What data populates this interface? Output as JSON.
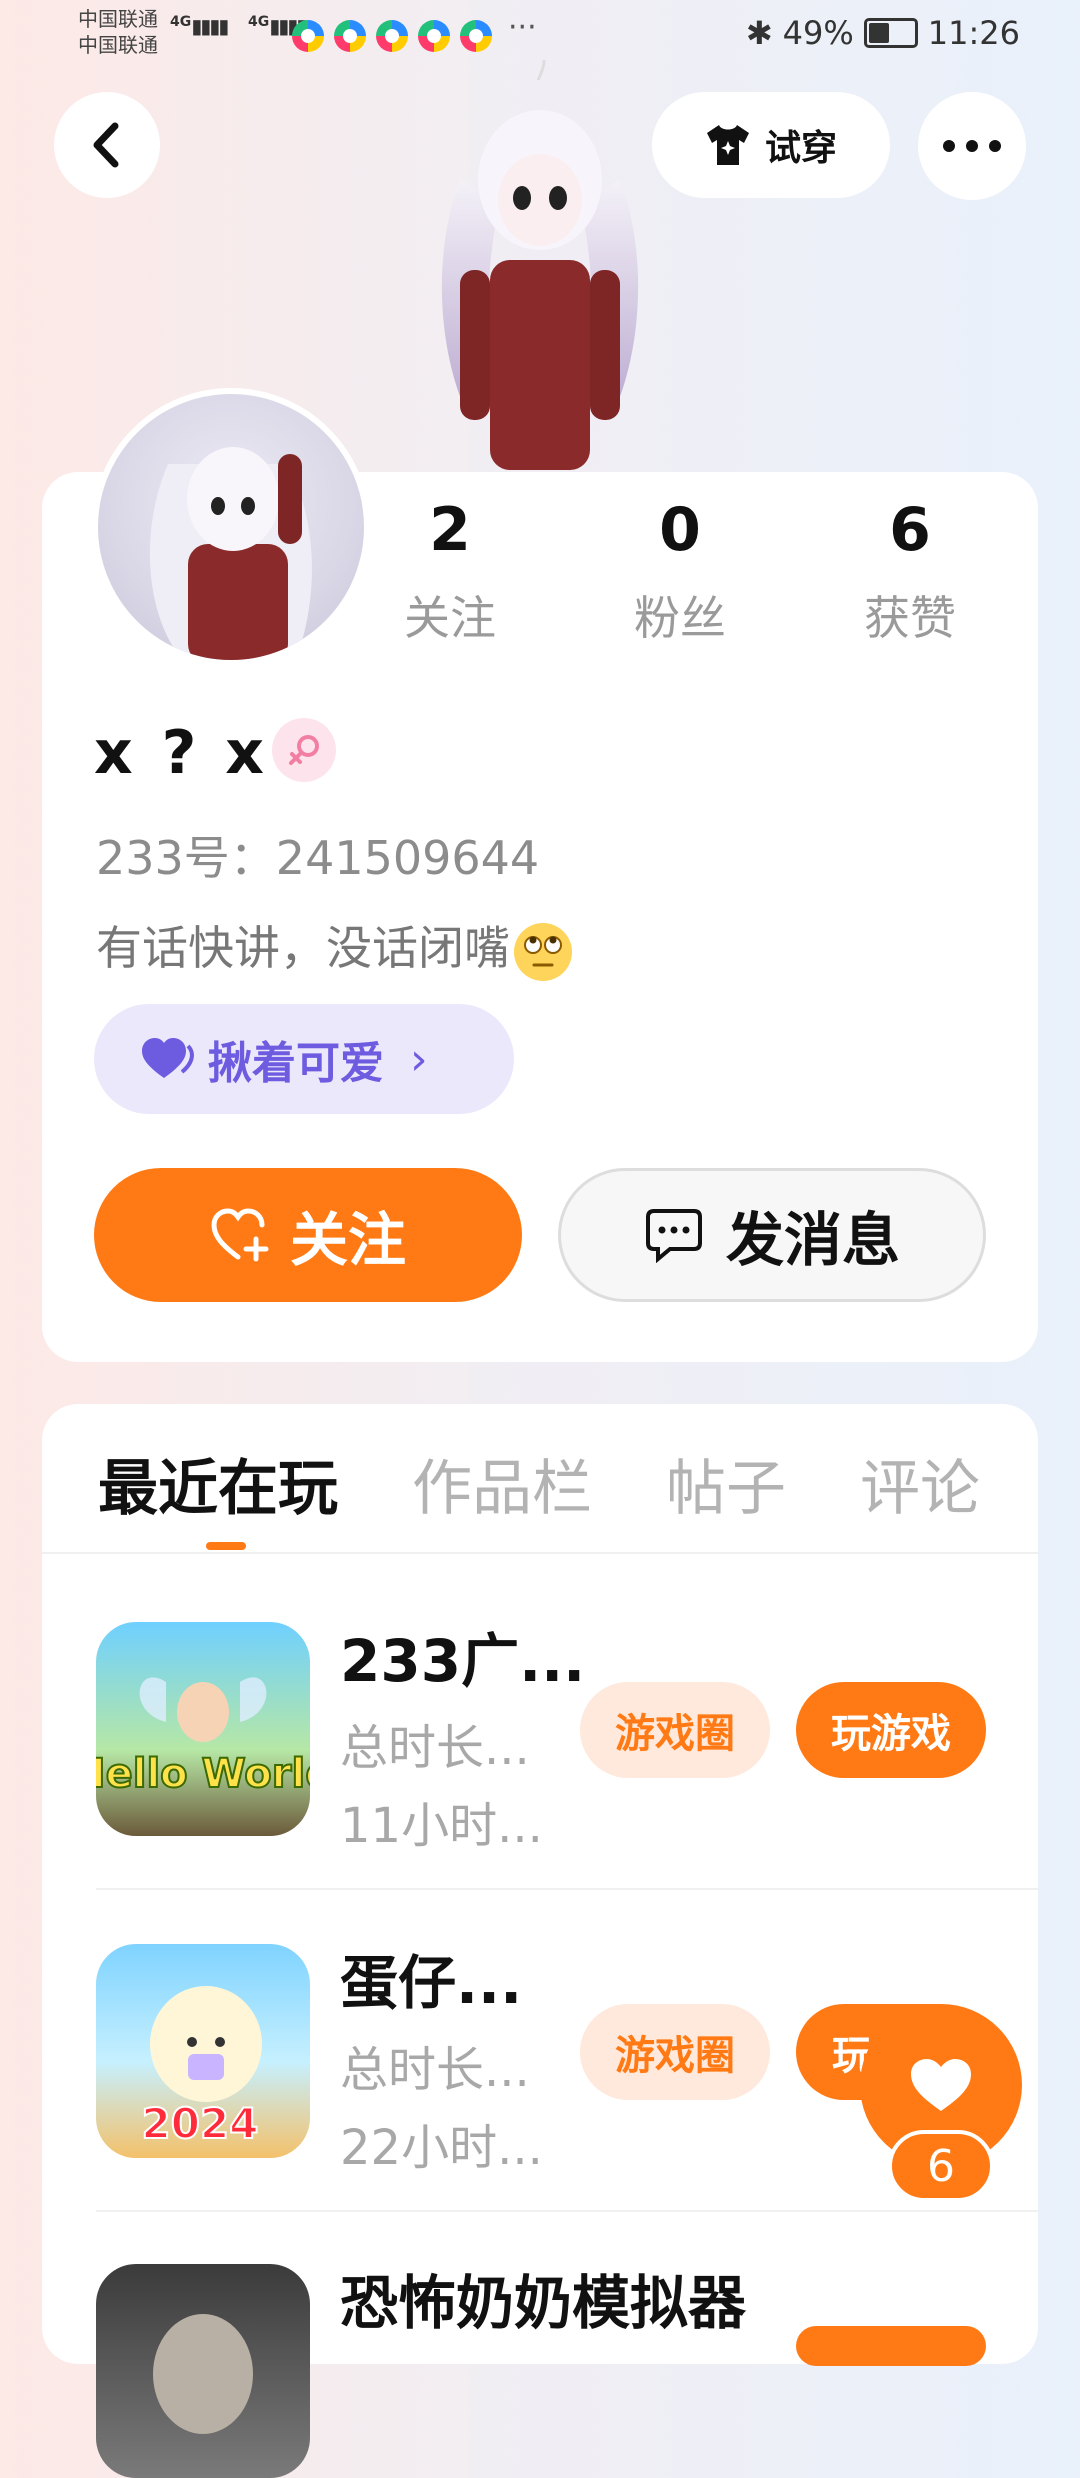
{
  "status_bar": {
    "carrier_1": "中国联通",
    "carrier_2": "中国联通",
    "net_1": "4G",
    "net_2": "4G",
    "overflow": "···",
    "battery_text": "49%",
    "battery_level": 0.49,
    "time": "11:26"
  },
  "header": {
    "tryon_label": "试穿"
  },
  "profile": {
    "stats": [
      {
        "value": "2",
        "label": "关注"
      },
      {
        "value": "0",
        "label": "粉丝"
      },
      {
        "value": "6",
        "label": "获赞"
      }
    ],
    "name": "x ? x",
    "gender_icon": "female-icon",
    "uid": "233号：241509644",
    "bio": "有话快讲，没话闭嘴",
    "tag": "揪着可爱",
    "follow_label": "关注",
    "message_label": "发消息"
  },
  "tabs": [
    "最近在玩",
    "作品栏",
    "帖子",
    "评论"
  ],
  "games": [
    {
      "title": "233广...",
      "time_label": "总时长...",
      "time_value": "11小时...",
      "circle": "游戏圈",
      "play": "玩游戏",
      "icon_text": "Hello World"
    },
    {
      "title": "蛋仔...",
      "time_label": "总时长...",
      "time_value": "22小时...",
      "circle": "游戏圈",
      "play": "玩",
      "icon_text": "2024"
    },
    {
      "title": "恐怖奶奶模拟器",
      "time_label": "",
      "time_value": "",
      "circle": "",
      "play": "",
      "icon_text": ""
    }
  ],
  "like_fab": {
    "count": "6"
  },
  "colors": {
    "accent": "#ff7a14",
    "tag_purple": "#6e5ce0"
  }
}
